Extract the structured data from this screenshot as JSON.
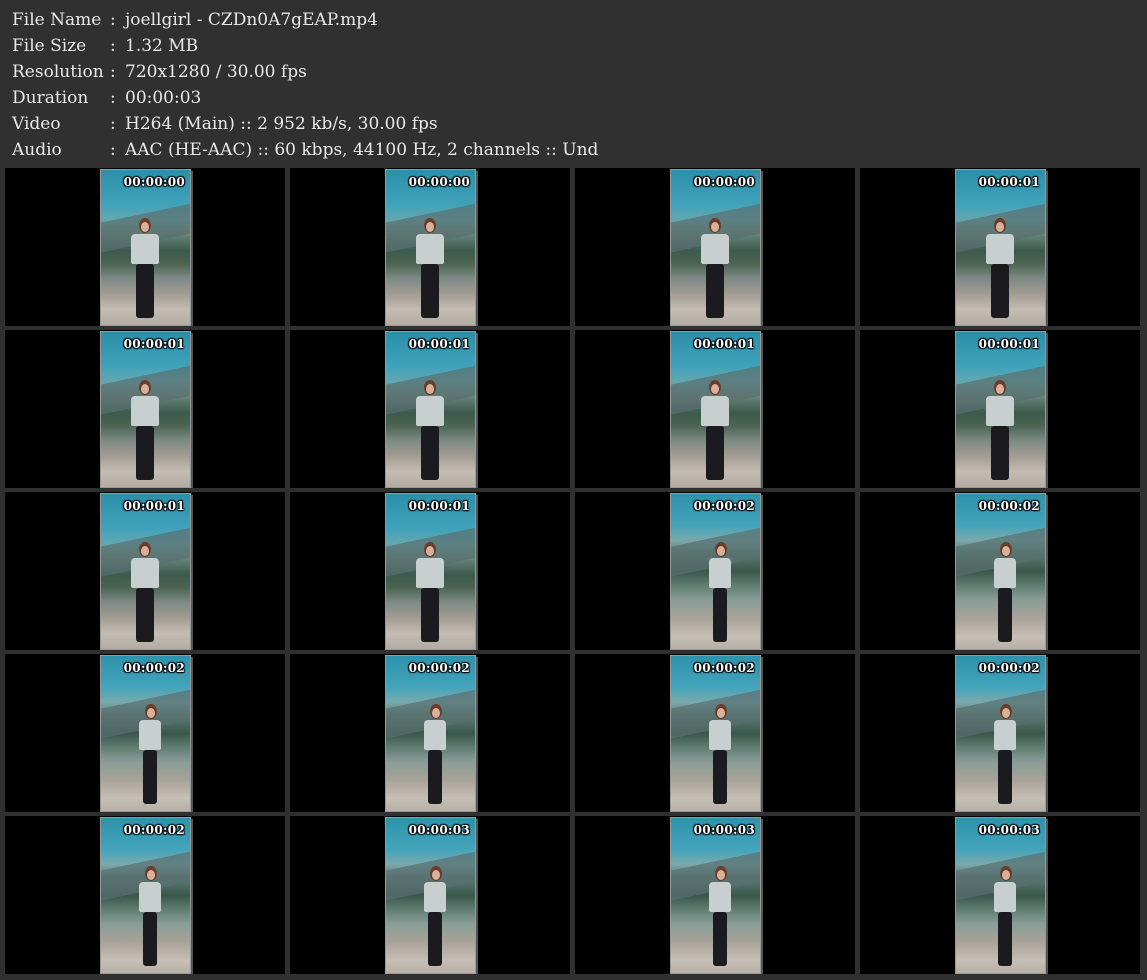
{
  "info": [
    {
      "label": "File Name",
      "value": "joellgirl - CZDn0A7gEAP.mp4"
    },
    {
      "label": "File Size",
      "value": "1.32 MB"
    },
    {
      "label": "Resolution",
      "value": "720x1280 / 30.00 fps"
    },
    {
      "label": "Duration",
      "value": "00:00:03"
    },
    {
      "label": "Video",
      "value": "H264 (Main) :: 2 952 kb/s, 30.00 fps"
    },
    {
      "label": "Audio",
      "value": "AAC (HE-AAC) :: 60 kbps, 44100 Hz, 2 channels :: Und"
    }
  ],
  "separator": ":",
  "thumbnails": [
    "00:00:00",
    "00:00:00",
    "00:00:00",
    "00:00:01",
    "00:00:01",
    "00:00:01",
    "00:00:01",
    "00:00:01",
    "00:00:01",
    "00:00:01",
    "00:00:02",
    "00:00:02",
    "00:00:02",
    "00:00:02",
    "00:00:02",
    "00:00:02",
    "00:00:02",
    "00:00:03",
    "00:00:03",
    "00:00:03"
  ]
}
